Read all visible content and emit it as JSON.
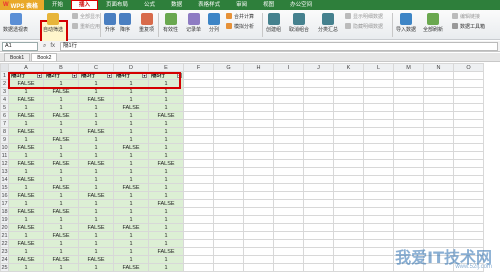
{
  "app": {
    "logo_text": "WPS 表格",
    "menu": [
      "开始",
      "插入",
      "页面布局",
      "公式",
      "数据",
      "表格样式",
      "审阅",
      "视图",
      "办公空间"
    ],
    "active_menu_index": 1
  },
  "ribbon": {
    "pivot": "数据透视表",
    "autofilter": "自动筛选",
    "reapply": "重新应用",
    "show_all": "全部显示",
    "sort_asc": "升序",
    "sort_desc": "降序",
    "duplicates": "重复项",
    "validity": "有效性",
    "record": "记录单",
    "split": "分列",
    "simulate": "模拟分析",
    "consolidate": "合并计算",
    "group": "创建组",
    "ungroup": "取消组合",
    "subtotal": "分类汇总",
    "show_detail": "显示明细数据",
    "hide_detail": "隐藏明细数据",
    "import": "导入数据",
    "refresh_all": "全部刷新",
    "edit_links": "编辑链接",
    "data_manage": "数据工具箱"
  },
  "formula_bar": {
    "cell_ref": "A1",
    "fx": "fx",
    "content": "隔1行"
  },
  "tabs": [
    "Book1",
    "Book2"
  ],
  "active_tab_index": 1,
  "columns": [
    "A",
    "B",
    "C",
    "D",
    "E",
    "F",
    "G",
    "H",
    "I",
    "J",
    "K",
    "L",
    "M",
    "N",
    "O"
  ],
  "headers": [
    "隔1行",
    "隔2行",
    "隔3行",
    "隔4行",
    "隔5行"
  ],
  "rows": [
    [
      "FALSE",
      "1",
      "1",
      "1",
      "1"
    ],
    [
      "1",
      "FALSE",
      "1",
      "1",
      "1"
    ],
    [
      "FALSE",
      "1",
      "FALSE",
      "1",
      "1"
    ],
    [
      "1",
      "1",
      "1",
      "FALSE",
      "1"
    ],
    [
      "FALSE",
      "FALSE",
      "1",
      "1",
      "FALSE"
    ],
    [
      "1",
      "1",
      "1",
      "1",
      "1"
    ],
    [
      "FALSE",
      "1",
      "FALSE",
      "1",
      "1"
    ],
    [
      "1",
      "FALSE",
      "1",
      "1",
      "1"
    ],
    [
      "FALSE",
      "1",
      "1",
      "FALSE",
      "1"
    ],
    [
      "1",
      "1",
      "1",
      "1",
      "1"
    ],
    [
      "FALSE",
      "FALSE",
      "FALSE",
      "1",
      "FALSE"
    ],
    [
      "1",
      "1",
      "1",
      "1",
      "1"
    ],
    [
      "FALSE",
      "1",
      "1",
      "1",
      "1"
    ],
    [
      "1",
      "FALSE",
      "1",
      "FALSE",
      "1"
    ],
    [
      "FALSE",
      "1",
      "FALSE",
      "1",
      "1"
    ],
    [
      "1",
      "1",
      "1",
      "1",
      "FALSE"
    ],
    [
      "FALSE",
      "FALSE",
      "1",
      "1",
      "1"
    ],
    [
      "1",
      "1",
      "1",
      "1",
      "1"
    ],
    [
      "FALSE",
      "1",
      "FALSE",
      "FALSE",
      "1"
    ],
    [
      "1",
      "FALSE",
      "1",
      "1",
      "1"
    ],
    [
      "FALSE",
      "1",
      "1",
      "1",
      "1"
    ],
    [
      "1",
      "1",
      "1",
      "1",
      "FALSE"
    ],
    [
      "FALSE",
      "FALSE",
      "FALSE",
      "1",
      "1"
    ],
    [
      "1",
      "1",
      "1",
      "FALSE",
      "1"
    ]
  ],
  "watermark": {
    "text": "我爱IT技术网",
    "url": "www.52ij.com"
  },
  "colors": {
    "app_green": "#2e7f3b",
    "data_fill": "#dcefd4",
    "highlight_red": "#d40000"
  }
}
